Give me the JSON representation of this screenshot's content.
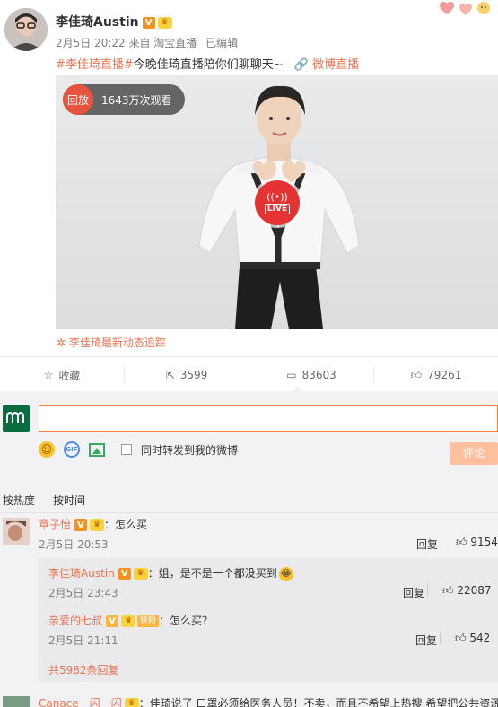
{
  "post": {
    "author": "李佳琦Austin",
    "verified_mark": "V",
    "meta": "2月5日 20:22 来自 淘宝直播",
    "edited": "已编辑",
    "topic": "#李佳琦直播#",
    "text": "今晚佳琦直播陪你们聊聊天~",
    "link_label": "微博直播",
    "video": {
      "replay_label": "回放",
      "views": "1643万次观看",
      "live_label": "LIVE"
    },
    "tracking_label": "李佳琦最新动态追踪"
  },
  "actions": {
    "favorite": "收藏",
    "repost": "3599",
    "comment": "83603",
    "like": "79261"
  },
  "composer": {
    "sync_label": "同时转发到我的微博",
    "submit_label": "评论"
  },
  "sort_tabs": {
    "hot": "按热度",
    "time": "按时间"
  },
  "comments": [
    {
      "user": "章子怡",
      "verified_mark": "V",
      "text": "：怎么买",
      "time": "2月5日 20:53",
      "reply_label": "回复",
      "likes": "9154"
    }
  ],
  "replies": [
    {
      "user": "李佳琦Austin",
      "verified_mark": "V",
      "text": "：姐，是不是一个都没买到",
      "time": "2月5日 23:43",
      "reply_label": "回复",
      "likes": "22087"
    },
    {
      "user": "亲爱的七叔",
      "verified_mark": "V",
      "fan_badge": "铁粉",
      "text": "：怎么买？",
      "time": "2月5日 21:11",
      "reply_label": "回复",
      "likes": "542"
    }
  ],
  "more_replies": "共5982条回复",
  "next_comment": {
    "user": "Canace一闪一闪",
    "text": "：佳琦说了 口罩必须给医务人员！不卖，而且不希望上热搜 希望把公共资源"
  },
  "colors": {
    "accent": "#eb7350",
    "input_border": "#fa7d3c",
    "submit_bg": "#ffc09f",
    "live_red": "#e53333"
  }
}
